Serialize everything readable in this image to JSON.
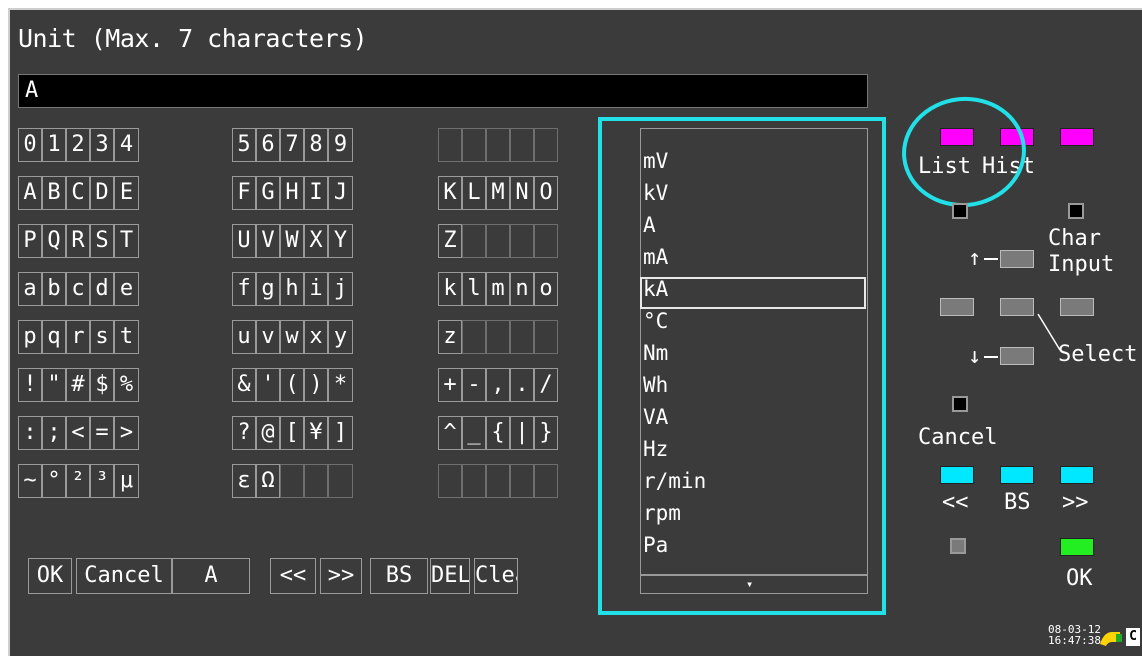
{
  "dialog": {
    "title": "Unit (Max. 7 characters)",
    "entry_value": "A"
  },
  "keyboard": {
    "rows": [
      [
        "0",
        "1",
        "2",
        "3",
        "4",
        "5",
        "6",
        "7",
        "8",
        "9",
        "",
        "",
        "",
        "",
        ""
      ],
      [
        "A",
        "B",
        "C",
        "D",
        "E",
        "F",
        "G",
        "H",
        "I",
        "J",
        "K",
        "L",
        "M",
        "N",
        "O"
      ],
      [
        "P",
        "Q",
        "R",
        "S",
        "T",
        "U",
        "V",
        "W",
        "X",
        "Y",
        "Z",
        "",
        "",
        "",
        ""
      ],
      [
        "a",
        "b",
        "c",
        "d",
        "e",
        "f",
        "g",
        "h",
        "i",
        "j",
        "k",
        "l",
        "m",
        "n",
        "o"
      ],
      [
        "p",
        "q",
        "r",
        "s",
        "t",
        "u",
        "v",
        "w",
        "x",
        "y",
        "z",
        "",
        "",
        "",
        ""
      ],
      [
        "!",
        "\"",
        "#",
        "$",
        "%",
        "&",
        "'",
        "(",
        ")",
        "*",
        "+",
        "-",
        ",",
        ".",
        "/"
      ],
      [
        ":",
        ";",
        "<",
        "=",
        ">",
        "?",
        "@",
        "[",
        "¥",
        "]",
        "^",
        "_",
        "{",
        "|",
        "}"
      ],
      [
        "~",
        "°",
        "²",
        "³",
        "μ",
        "ε",
        "Ω",
        "",
        "",
        "",
        "",
        "",
        "",
        "",
        ""
      ]
    ],
    "bottom_buttons": [
      "OK",
      "Cancel",
      "A",
      "<<",
      ">>",
      "BS",
      "DEL",
      "Clear"
    ]
  },
  "unit_list": {
    "items": [
      "mV",
      "kV",
      "A",
      "mA",
      "kA",
      "°C",
      "Nm",
      "Wh",
      "VA",
      "Hz",
      "r/min",
      "rpm",
      "Pa"
    ],
    "selected": "kA",
    "scroll_indicator": "▾"
  },
  "panel": {
    "list_label": "List",
    "hist_label": "Hist",
    "up_arrow": "↑",
    "down_arrow": "↓",
    "char_label": "Char",
    "input_label": "Input",
    "select_label": "Select",
    "cancel_label": "Cancel",
    "prev_label": "<<",
    "bs_label": "BS",
    "next_label": ">>",
    "ok_label": "OK"
  },
  "status": {
    "date": "08-03-12",
    "time": "16:47:38",
    "power_icon": "power-plug-icon",
    "card_label": "C"
  },
  "colors": {
    "background": "#3b3b3b",
    "highlight": "#22e0e8",
    "list_key": "#ff00ff",
    "nav_key": "#00e8ff",
    "ok_key": "#22ee22"
  }
}
